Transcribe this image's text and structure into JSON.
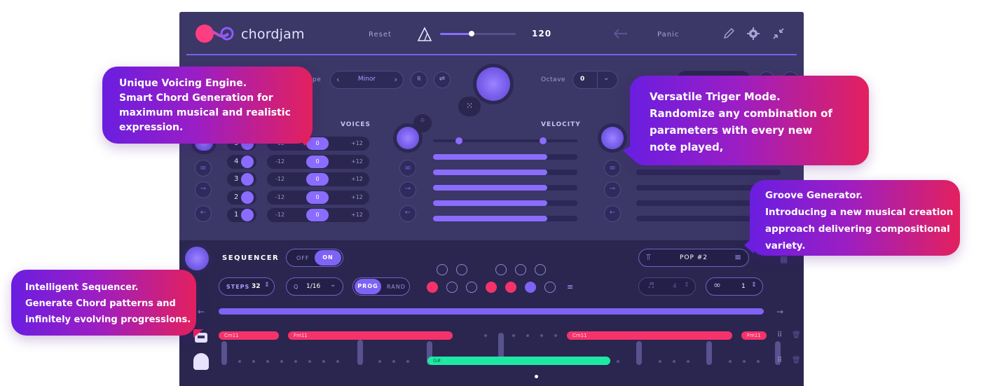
{
  "header": {
    "logo_text": "chordjam",
    "reset_label": "Reset",
    "bpm": "120",
    "panic_label": "Panic",
    "tempo_fraction": 0.42,
    "icons": [
      "pencil-icon",
      "gear-icon",
      "collapse-icon",
      "undo-icon",
      "tempo-triangle-icon"
    ]
  },
  "scale": {
    "type_label_fragment": "pe",
    "mode_value": "Minor",
    "reset_letter": "R"
  },
  "octave": {
    "label": "Octave",
    "value": "0"
  },
  "voices": {
    "label": "VOICES",
    "rows": [
      {
        "num": "5",
        "low": "-12",
        "mid": "0",
        "high": "+12"
      },
      {
        "num": "4",
        "low": "-12",
        "mid": "0",
        "high": "+12"
      },
      {
        "num": "3",
        "low": "-12",
        "mid": "0",
        "high": "+12"
      },
      {
        "num": "2",
        "low": "-12",
        "mid": "0",
        "high": "+12"
      },
      {
        "num": "1",
        "low": "-12",
        "mid": "0",
        "high": "+12"
      }
    ]
  },
  "velocity": {
    "label": "VELOCITY",
    "bar_levels": [
      0.79,
      0.79,
      0.79,
      0.79,
      0.79
    ]
  },
  "sequencer": {
    "title": "SEQUENCER",
    "off_label": "OFF",
    "on_label": "ON",
    "steps_label": "STEPS",
    "steps_value": "32",
    "q_label": "Q",
    "q_value": "1/16",
    "prog_label": "PROG",
    "rand_label": "RAND"
  },
  "groove": {
    "preset": "POP #2",
    "notes_value": "4",
    "repeat_value": "1"
  },
  "tracks": {
    "chords": [
      {
        "label": "Cm11"
      },
      {
        "label": "Fm11"
      },
      {
        "label": "Cm11"
      },
      {
        "label": "Fm11"
      }
    ],
    "green_label": "G#"
  },
  "callouts": {
    "voicing": [
      "Unique Voicing Engine.",
      "Smart Chord Generation for",
      "maximum musical and realistic",
      "expression."
    ],
    "trigger": [
      "Versatile Triger Mode.",
      "Randomize any combination of",
      "parameters with every new",
      "note played,"
    ],
    "groove": [
      "Groove Generator.",
      "Introducing a new musical creation",
      "approach delivering compositional",
      "variety."
    ],
    "sequencer": [
      "Intelligent Sequencer.",
      "Generate Chord patterns and",
      "infinitely evolving progressions."
    ]
  },
  "colors": {
    "accent": "#7f63f4",
    "chord_red": "#f5336a",
    "green": "#1de9a3",
    "panel": "#3a3565"
  }
}
